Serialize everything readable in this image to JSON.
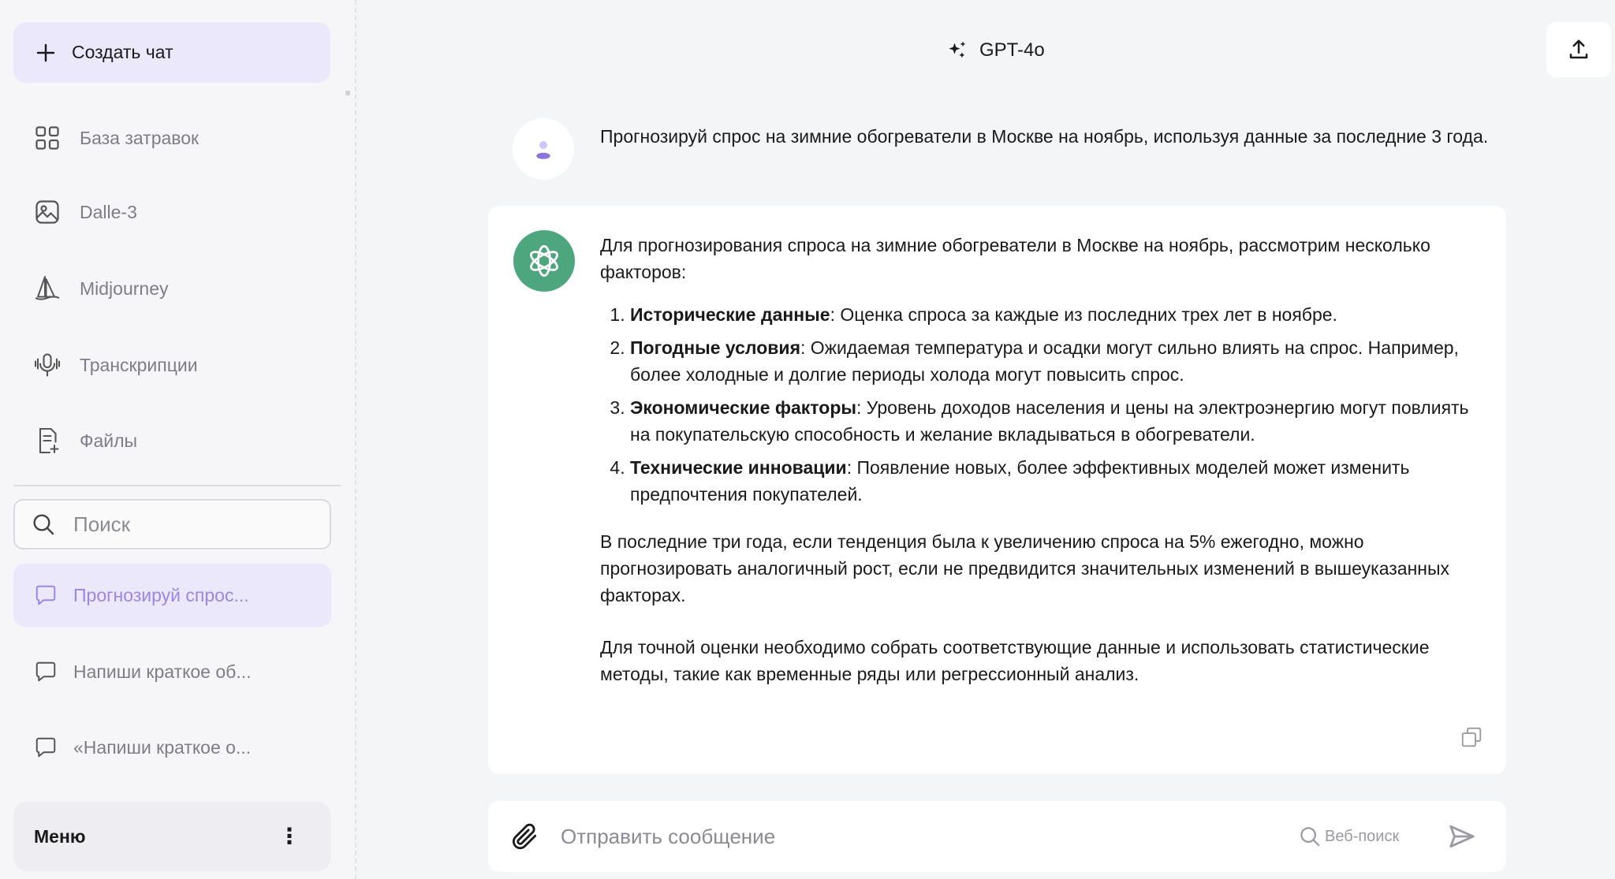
{
  "sidebar": {
    "new_chat_label": "Создать чат",
    "nav": [
      {
        "label": "База затравок",
        "icon": "grid-icon"
      },
      {
        "label": "Dalle-3",
        "icon": "image-icon"
      },
      {
        "label": "Midjourney",
        "icon": "sailboat-icon"
      },
      {
        "label": "Транскрипции",
        "icon": "microphone-icon"
      },
      {
        "label": "Файлы",
        "icon": "file-add-icon"
      }
    ],
    "search_placeholder": "Поиск",
    "chats": [
      {
        "label": "Прогнозируй спрос...",
        "active": true
      },
      {
        "label": "Напиши краткое об...",
        "active": false
      },
      {
        "label": "«Напиши краткое о...",
        "active": false
      }
    ],
    "menu_label": "Меню"
  },
  "header": {
    "model": "GPT-4o"
  },
  "conversation": {
    "user_message": "Прогнозируй спрос на зимние обогреватели в Москве на ноябрь, используя данные за последние 3 года.",
    "assistant": {
      "intro": "Для прогнозирования спроса на зимние обогреватели в Москве на ноябрь, рассмотрим несколько факторов:",
      "factors": [
        {
          "title": "Исторические данные",
          "text": ": Оценка спроса за каждые из последних трех лет в ноябре."
        },
        {
          "title": "Погодные условия",
          "text": ": Ожидаемая температура и осадки могут сильно влиять на спрос. Например, более холодные и долгие периоды холода могут повысить спрос."
        },
        {
          "title": "Экономические факторы",
          "text": ": Уровень доходов населения и цены на электроэнергию могут повлиять на покупательскую способность и желание вкладываться в обогреватели."
        },
        {
          "title": "Технические инновации",
          "text": ": Появление новых, более эффективных моделей может изменить предпочтения покупателей."
        }
      ],
      "paragraph2": "В последние три года, если тенденция была к увеличению спроса на 5% ежегодно, можно прогнозировать аналогичный рост, если не предвидится значительных изменений в вышеуказанных факторах.",
      "paragraph3": "Для точной оценки необходимо собрать соответствующие данные и использовать статистические методы, такие как временные ряды или регрессионный анализ."
    }
  },
  "composer": {
    "placeholder": "Отправить сообщение",
    "web_search_label": "Веб-поиск"
  },
  "colors": {
    "accent_bg": "#ece8fb",
    "accent_text": "#9b86e6",
    "assistant_avatar": "#4ea67f"
  }
}
